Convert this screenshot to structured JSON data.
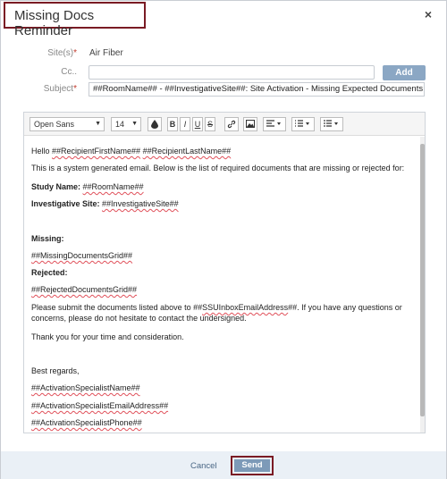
{
  "dialog": {
    "title": "Missing Docs Reminder",
    "close_label": "×"
  },
  "form": {
    "sites_label": "Site(s)",
    "sites_value": "Air Fiber",
    "cc_label": "Cc..",
    "cc_value": "",
    "add_label": "Add",
    "subject_label": "Subject",
    "required_mark": "*",
    "subject_value": "##RoomName## - ##InvestigativeSite##: Site Activation - Missing Expected Documents"
  },
  "toolbar": {
    "font_family": "Open Sans",
    "font_size": "14",
    "bold": "B",
    "italic": "I",
    "underline": "U",
    "strike": "S"
  },
  "body": {
    "greeting_prefix": "Hello ",
    "greeting_first": "##RecipientFirstName##",
    "greeting_space": " ",
    "greeting_last": "##RecipientLastName##",
    "intro": "This is a system generated email. Below is the list of required documents that are missing or rejected for:",
    "study_label": "Study Name:",
    "study_value": "##RoomName##",
    "site_label": "Investigative Site:",
    "site_value": "##InvestigativeSite##",
    "missing_label": "Missing:",
    "missing_grid": "##MissingDocumentsGrid##",
    "rejected_label": "Rejected:",
    "rejected_grid": "##RejectedDocumentsGrid##",
    "submit_prefix": "Please submit the documents listed above to ##",
    "submit_token": "SSUInboxEmailAddress",
    "submit_suffix": "##. If you have any questions or",
    "submit_line2": "concerns, please do not hesitate to contact the undersigned.",
    "thanks": "Thank you for your time and consideration.",
    "regards": "Best regards,",
    "spec_name": "##ActivationSpecialistName##",
    "spec_email": "##ActivationSpecialistEmailAddress##",
    "spec_phone": "##ActivationSpecialistPhone##"
  },
  "footer": {
    "cancel_label": "Cancel",
    "send_label": "Send"
  },
  "colors": {
    "highlight_border": "#7a1b24",
    "primary_button": "#7d9ab8",
    "add_button": "#8ba7c4",
    "footer_bg": "#eaf0f6",
    "required": "#c0392b"
  },
  "icons": [
    "close-icon",
    "text-color-icon",
    "link-icon",
    "image-icon",
    "align-icon",
    "ordered-list-icon",
    "unordered-list-icon",
    "chevron-down-icon"
  ]
}
